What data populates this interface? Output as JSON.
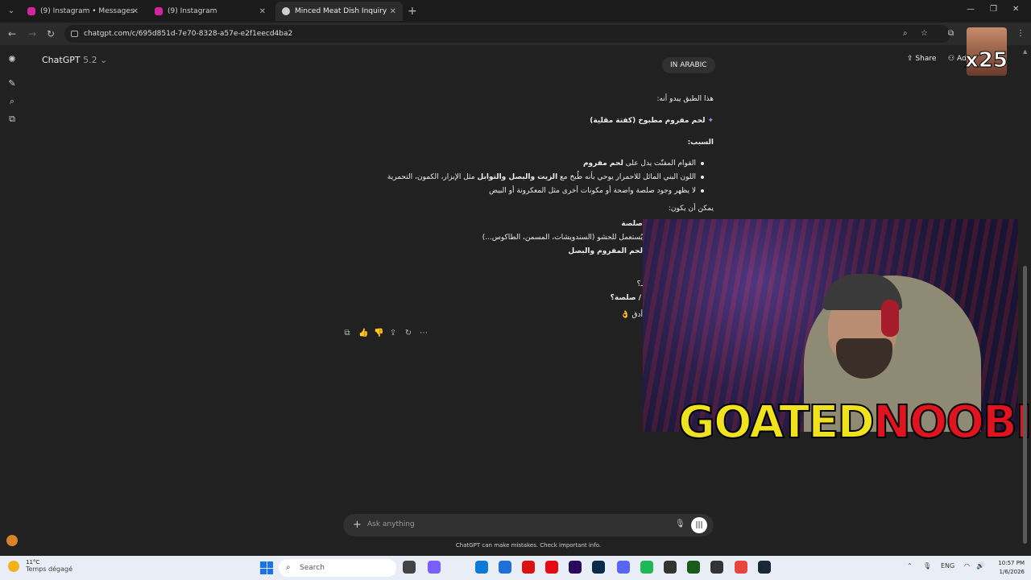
{
  "tabs": [
    {
      "label": "(9) Instagram • Messages",
      "favicon_color": "#d6249f"
    },
    {
      "label": "(9) Instagram",
      "favicon_color": "#d6249f"
    },
    {
      "label": "Minced Meat Dish Inquiry",
      "favicon_color": "#cfcfcf",
      "active": true
    }
  ],
  "address": {
    "url": "chatgpt.com/c/695d851d-7e70-8328-a57e-e2f1eecd4ba2"
  },
  "header": {
    "model": "ChatGPT",
    "version": "5.2",
    "share_label": "Share",
    "add_label": "Ad"
  },
  "conversation": {
    "user_message": "IN ARABIC",
    "reply": {
      "intro": "هذا الطبق يبدو أنه:",
      "dish": "لحم مفروم مطبوخ (كفتة مقلية)",
      "reason_title": "السبب:",
      "bullets": [
        {
          "text_pre": "القوام المفتّت يدل على ",
          "bold": "لحم مفروم"
        },
        {
          "text_pre": "اللون البني المائل للاحمرار يوحي بأنه طُبخ مع ",
          "bold": "الزيت والبصل والتوابل",
          "text_post": " مثل الإبزار، الكمون، التحمرية"
        },
        {
          "text_pre": "لا يظهر وجود صلصة واضحة أو مكونات أخرى مثل المعكرونة أو البيض"
        }
      ],
      "maybe_title": "يمكن أن يكون:",
      "partial_1": "صلصة",
      "partial_2": "يُستعمل للحشو (السندويشات، المسمن، الطاكوس...)",
      "partial_3": "لحم المفروم والبصل",
      "partial_4": "ـ؟",
      "partial_5": "/ صلصة؟",
      "partial_6": "أدق 👌"
    }
  },
  "overlay": {
    "corner_count": "x25",
    "logo_part1": "GOATED",
    "logo_part2": "NOOBIE"
  },
  "composer": {
    "placeholder": "Ask anything",
    "disclaimer": "ChatGPT can make mistakes. Check important info."
  },
  "taskbar": {
    "weather_temp": "11°C",
    "weather_desc": "Temps dégagé",
    "search_label": "Search",
    "language": "ENG",
    "time": "10:57 PM",
    "date": "1/6/2026"
  },
  "icons": {
    "rail": [
      "openai-logo-icon",
      "new-chat-icon",
      "search-icon",
      "library-icon"
    ],
    "actions": [
      "copy-icon",
      "thumbs-up-icon",
      "thumbs-down-icon",
      "share-icon",
      "regenerate-icon",
      "more-icon"
    ]
  }
}
